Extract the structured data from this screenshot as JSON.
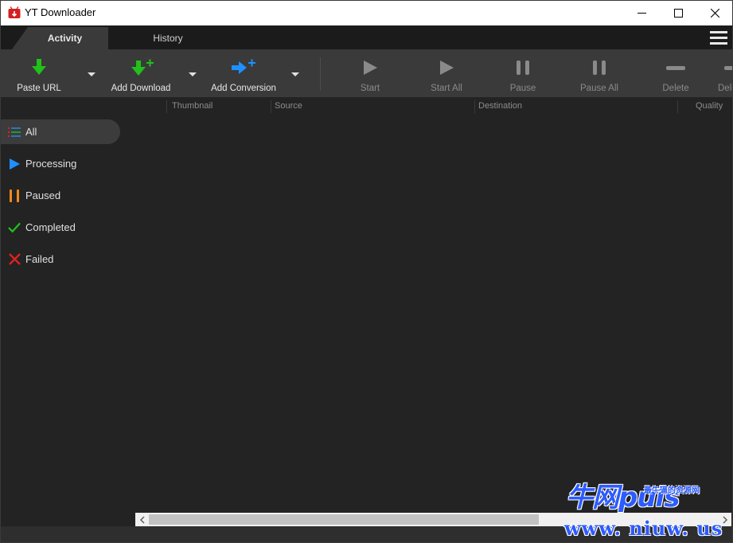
{
  "window": {
    "title": "YT Downloader",
    "app_icon": "tv-icon",
    "controls": [
      "minimize-icon",
      "maximize-icon",
      "close-icon"
    ]
  },
  "tabs": [
    {
      "label": "Activity",
      "active": true
    },
    {
      "label": "History",
      "active": false
    }
  ],
  "toolbar": {
    "buttons": [
      {
        "label": "Paste URL",
        "icon": "download-arrow-icon",
        "enabled": true,
        "dropdown": true
      },
      {
        "label": "Add Download",
        "icon": "download-plus-icon",
        "enabled": true,
        "dropdown": true
      },
      {
        "label": "Add Conversion",
        "icon": "convert-plus-icon",
        "enabled": true,
        "dropdown": true
      },
      {
        "label": "Start",
        "icon": "play-icon",
        "enabled": false
      },
      {
        "label": "Start All",
        "icon": "play-icon",
        "enabled": false
      },
      {
        "label": "Pause",
        "icon": "pause-icon",
        "enabled": false
      },
      {
        "label": "Pause All",
        "icon": "pause-icon",
        "enabled": false
      },
      {
        "label": "Delete",
        "icon": "minus-icon",
        "enabled": false
      },
      {
        "label": "Dele",
        "icon": "minus-icon",
        "enabled": false
      }
    ]
  },
  "columns": [
    "Thumbnail",
    "Source",
    "Destination",
    "Quality"
  ],
  "sidebar": {
    "items": [
      {
        "label": "All",
        "icon": "list-icon",
        "selected": true
      },
      {
        "label": "Processing",
        "icon": "play-icon",
        "selected": false
      },
      {
        "label": "Paused",
        "icon": "pause-icon",
        "selected": false
      },
      {
        "label": "Completed",
        "icon": "check-icon",
        "selected": false
      },
      {
        "label": "Failed",
        "icon": "x-icon",
        "selected": false
      }
    ]
  },
  "watermark": {
    "logo_text": "牛网puls",
    "tagline": "最牛逼的资源网",
    "url": "www. niuw. us"
  },
  "colors": {
    "green": "#22c01a",
    "blue": "#1e90ff",
    "orange": "#f08a1c",
    "red": "#e02020",
    "disabled": "#8a8a8a",
    "watermark": "#2c5bff"
  }
}
